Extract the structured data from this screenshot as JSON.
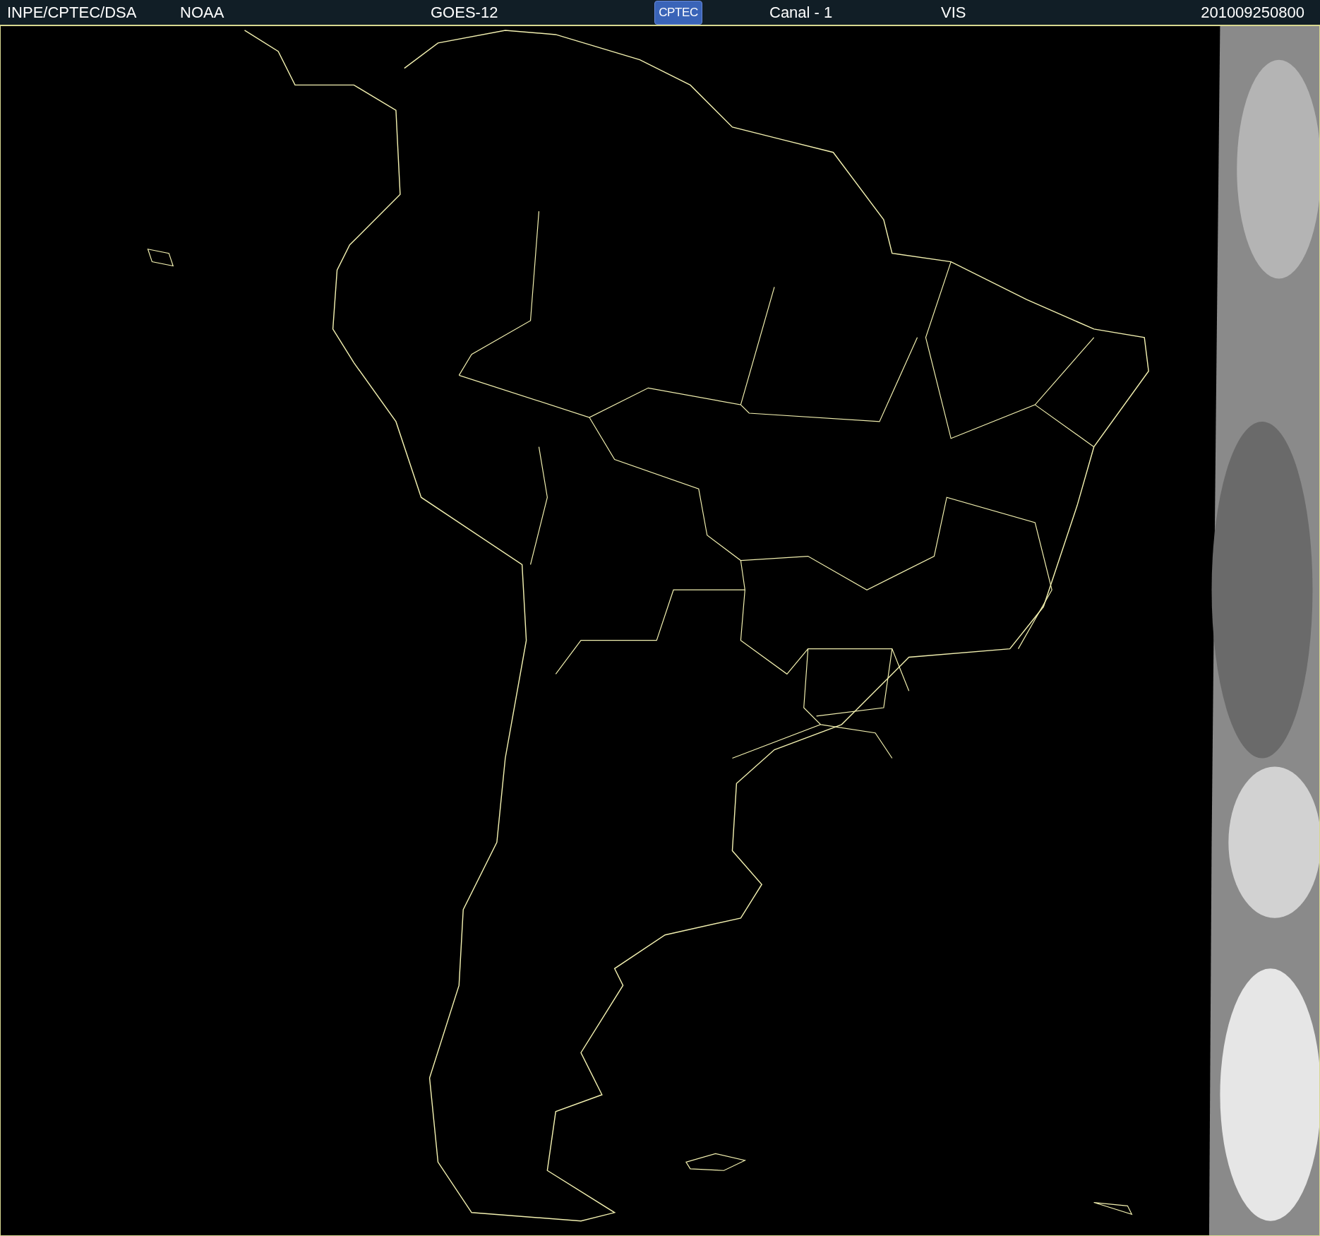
{
  "header": {
    "items": [
      {
        "kind": "text",
        "text": "INPE/CPTEC/DSA"
      },
      {
        "kind": "text",
        "text": "NOAA"
      },
      {
        "kind": "text",
        "text": "GOES-12"
      },
      {
        "kind": "logo",
        "text": "CPTEC"
      },
      {
        "kind": "text",
        "text": "Canal - 1"
      },
      {
        "kind": "text",
        "text": "VIS"
      },
      {
        "kind": "text",
        "text": "201009250800"
      }
    ]
  }
}
